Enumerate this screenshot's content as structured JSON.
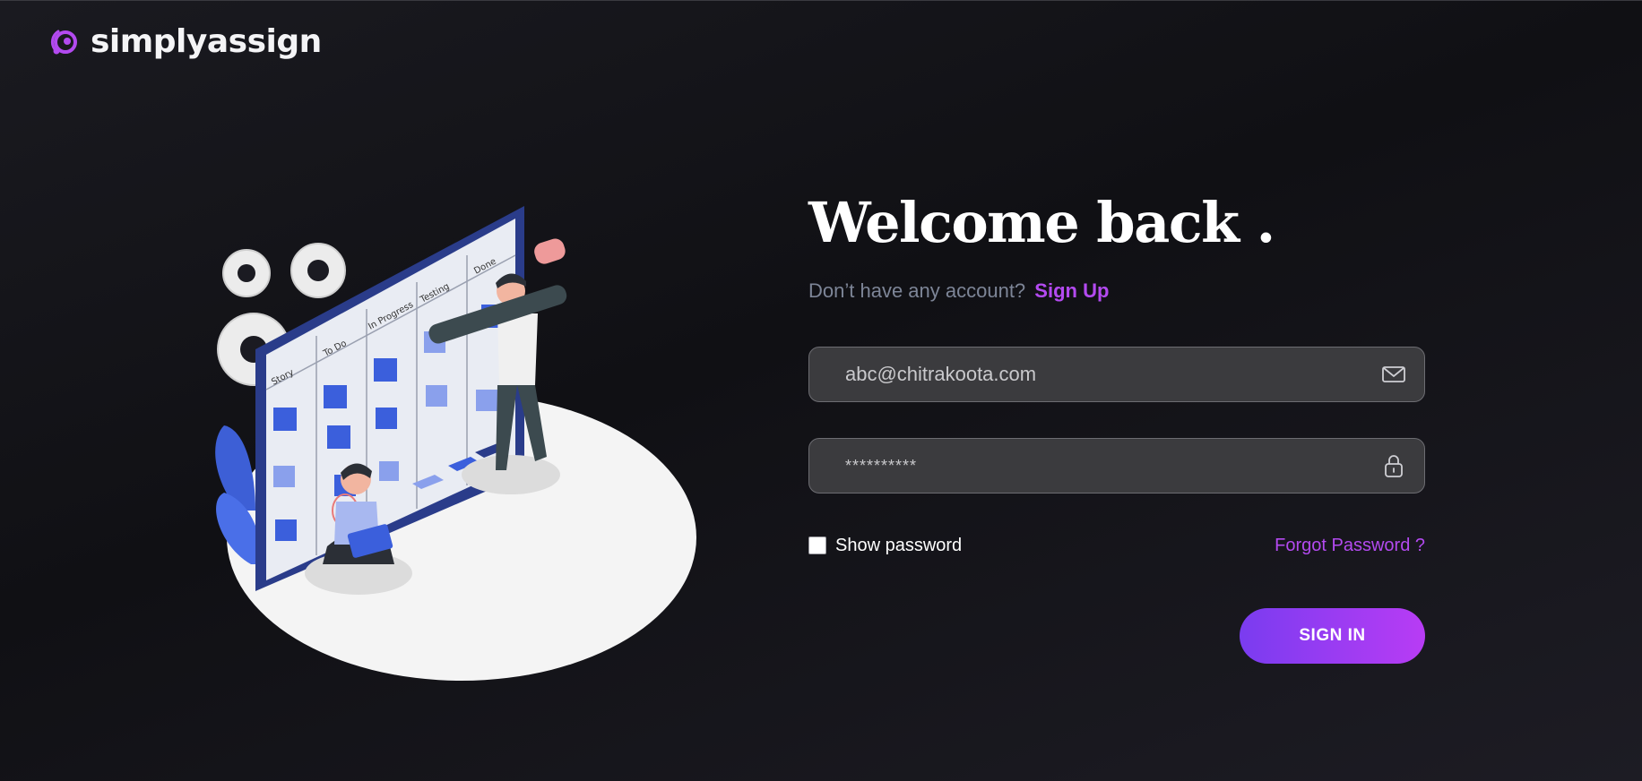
{
  "brand": {
    "name": "simplyassign",
    "accent_color": "#b34af0",
    "logo_icon": "orbit-logo-icon"
  },
  "illustration": {
    "board_columns": [
      "Story",
      "To Do",
      "In Progress",
      "Testing",
      "Done"
    ]
  },
  "login": {
    "heading": "Welcome back .",
    "signup_prompt": "Don’t have any account?",
    "signup_link": "Sign Up",
    "email_value": "abc@chitrakoota.com",
    "email_icon": "mail-icon",
    "password_value": "**********",
    "password_icon": "lock-icon",
    "show_password_label": "Show password",
    "forgot_password": "Forgot Password ?",
    "signin_button": "SIGN IN"
  }
}
